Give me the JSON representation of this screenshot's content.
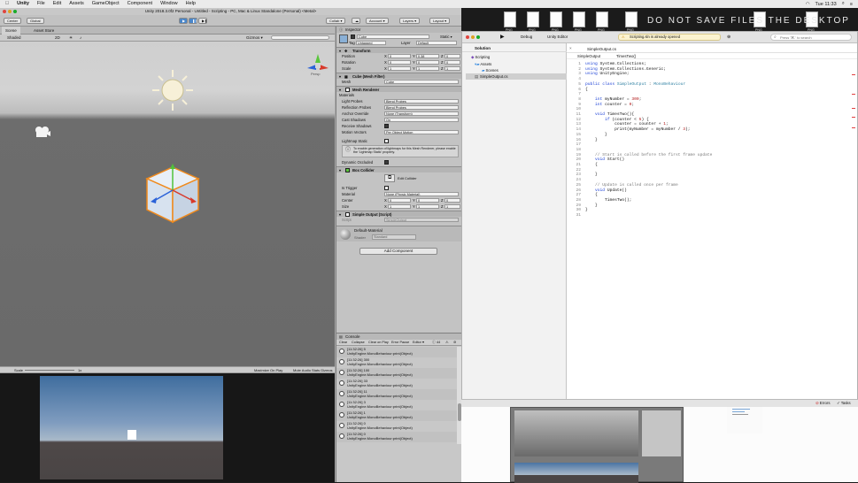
{
  "menubar": {
    "app": "Unity",
    "items": [
      "File",
      "Edit",
      "Assets",
      "GameObject",
      "Component",
      "Window",
      "Help"
    ],
    "clock": "Tue 11:33"
  },
  "unity": {
    "title": "Unity 2018.3.0f2 Personal - Untitled - Scripting - PC, Mac & Linux Standalone (Personal) <Metal>",
    "toolbar": {
      "center": "Center",
      "global": "Global",
      "collab": "Collab ▾",
      "account": "Account ▾",
      "layers": "Layers ▾",
      "layout": "Layout ▾"
    },
    "tabs": {
      "scene": "Scene",
      "asset_store": "Asset Store",
      "inspector": "Inspector"
    },
    "scene_bar": {
      "shaded": "Shaded",
      "dim": "2D",
      "gizmos": "Gizmos ▾",
      "persp": "Persp"
    },
    "game_bar": {
      "scale_label": "Scale",
      "scale_value": "1x",
      "maximize": "Maximize On Play",
      "mute": "Mute Audio",
      "stats": "Stats",
      "gizmos": "Gizmos ▾"
    }
  },
  "inspector": {
    "object_name": "Cube",
    "static_label": "Static ▾",
    "tag": "Untagged",
    "layer": "Default",
    "transform": {
      "title": "Transform",
      "position": {
        "label": "Position",
        "x": "0",
        "y": "0.38",
        "z": "0"
      },
      "rotation": {
        "label": "Rotation",
        "x": "0",
        "y": "0",
        "z": "0"
      },
      "scale": {
        "label": "Scale",
        "x": "1",
        "y": "1",
        "z": "1"
      }
    },
    "mesh_filter": {
      "title": "Cube (Mesh Filter)",
      "mesh_label": "Mesh",
      "mesh_value": "Cube"
    },
    "mesh_renderer": {
      "title": "Mesh Renderer",
      "materials": "Materials",
      "rows": [
        {
          "label": "Light Probes",
          "value": "Blend Probes"
        },
        {
          "label": "Reflection Probes",
          "value": "Blend Probes"
        },
        {
          "label": "Anchor Override",
          "value": "None (Transform)"
        },
        {
          "label": "Cast Shadows",
          "value": "On"
        },
        {
          "label": "Receive Shadows",
          "value": ""
        },
        {
          "label": "Motion Vectors",
          "value": "Per Object Motion"
        },
        {
          "label": "Lightmap Static",
          "value": ""
        }
      ],
      "info": "To enable generation of lightmaps for this Mesh Renderer, please enable the 'Lightmap Static' property.",
      "dynamic_occluded": "Dynamic Occluded"
    },
    "box_collider": {
      "title": "Box Collider",
      "edit": "Edit Collider",
      "is_trigger": "Is Trigger",
      "material_label": "Material",
      "material_value": "None (Physic Material)",
      "center": {
        "label": "Center",
        "x": "0",
        "y": "0",
        "z": "0"
      },
      "size": {
        "label": "Size",
        "x": "1",
        "y": "1",
        "z": "1"
      }
    },
    "script": {
      "title": "Simple Output (Script)",
      "label": "Script",
      "value": "SimpleOutput"
    },
    "material": {
      "name": "Default-Material",
      "shader_label": "Shader",
      "shader_value": "Standard"
    },
    "add_component": "Add Component"
  },
  "console": {
    "title": "Console",
    "buttons": [
      "Clear",
      "Collapse",
      "Clear on Play",
      "Error Pause",
      "Editor ▾"
    ],
    "count": "44",
    "entries": [
      {
        "line1": "[11:32:26] 5",
        "line2": "UnityEngine.MonoBehaviour:print(Object)"
      },
      {
        "line1": "[11:32:26] 300",
        "line2": "UnityEngine.MonoBehaviour:print(Object)"
      },
      {
        "line1": "[11:32:26] 100",
        "line2": "UnityEngine.MonoBehaviour:print(Object)"
      },
      {
        "line1": "[11:32:26] 33",
        "line2": "UnityEngine.MonoBehaviour:print(Object)"
      },
      {
        "line1": "[11:32:26] 11",
        "line2": "UnityEngine.MonoBehaviour:print(Object)"
      },
      {
        "line1": "[11:32:26] 3",
        "line2": "UnityEngine.MonoBehaviour:print(Object)"
      },
      {
        "line1": "[11:32:26] 1",
        "line2": "UnityEngine.MonoBehaviour:print(Object)"
      },
      {
        "line1": "[11:32:26] 0",
        "line2": "UnityEngine.MonoBehaviour:print(Object)"
      },
      {
        "line1": "[11:32:26] 0",
        "line2": "UnityEngine.MonoBehaviour:print(Object)"
      }
    ]
  },
  "desktop": {
    "banner": "DO NOT SAVE FILES THE DESKTOP",
    "icon_label": "PNG"
  },
  "vs": {
    "config": "Debug",
    "target": "Unity Editor",
    "notice": "Scripting.sln is already opened",
    "search_placeholder": "Press '⌘.' to search",
    "solution_title": "Solution",
    "tree": [
      "Scripting",
      "Assets",
      "Scenes",
      "SimpleOutput.cs"
    ],
    "file_tab": "SimpleOutput.cs",
    "breadcrumb1": "SimpleOutput",
    "breadcrumb2": "TimesTwo()",
    "code": [
      [
        "1",
        "using System.Collections;"
      ],
      [
        "2",
        "using System.Collections.Generic;"
      ],
      [
        "3",
        "using UnityEngine;"
      ],
      [
        "4",
        ""
      ],
      [
        "5",
        "public class SimpleOutput : MonoBehaviour"
      ],
      [
        "6",
        "{"
      ],
      [
        "7",
        ""
      ],
      [
        "8",
        "    int myNumber = 300;"
      ],
      [
        "9",
        "    int counter = 0;"
      ],
      [
        "10",
        ""
      ],
      [
        "11",
        "    void TimesTwo(){"
      ],
      [
        "12",
        "        if (counter < 5) {"
      ],
      [
        "13",
        "            counter = counter + 1;"
      ],
      [
        "14",
        "            print(myNumber = myNumber / 3);"
      ],
      [
        "15",
        "        }"
      ],
      [
        "16",
        "    }"
      ],
      [
        "17",
        ""
      ],
      [
        "18",
        ""
      ],
      [
        "19",
        "    // Start is called before the first frame update"
      ],
      [
        "20",
        "    void Start()"
      ],
      [
        "21",
        "    {"
      ],
      [
        "22",
        ""
      ],
      [
        "23",
        "    }"
      ],
      [
        "24",
        ""
      ],
      [
        "25",
        "    // Update is called once per frame"
      ],
      [
        "26",
        "    void Update()"
      ],
      [
        "27",
        "    {"
      ],
      [
        "28",
        "        TimesTwo();"
      ],
      [
        "29",
        "    }"
      ],
      [
        "30",
        "}"
      ],
      [
        "31",
        ""
      ]
    ],
    "status_errors": "Errors",
    "status_tasks": "Tasks"
  }
}
